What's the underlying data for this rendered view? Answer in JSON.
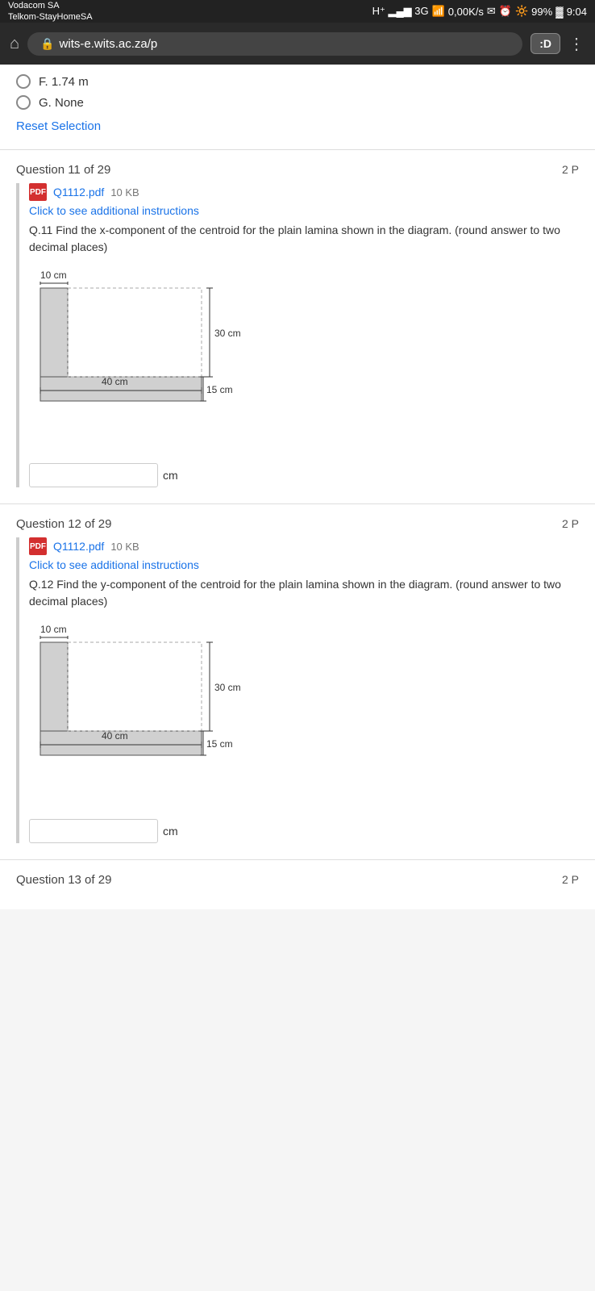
{
  "statusBar": {
    "carrier1": "Vodacom SA",
    "carrier2": "Telkom-StayHomeSA",
    "signal": "H⁺",
    "network": "3G",
    "wifi": "0,00K/s",
    "icons": "M O O",
    "battery": "99%",
    "time": "9:04"
  },
  "browser": {
    "url": "wits-e.wits.ac.za/p",
    "badge": ":D"
  },
  "prevQuestion": {
    "optionF": "F. 1.74 m",
    "optionG": "G. None",
    "resetLabel": "Reset Selection"
  },
  "question11": {
    "number": "Question 11 of 29",
    "points": "2 P",
    "pdfName": "Q1112.pdf",
    "pdfSize": "10 KB",
    "additionalLink": "Click to see additional instructions",
    "text": "Q.11 Find the x-component of the centroid for the plain lamina shown in the diagram. (round answer to two decimal places)",
    "diagramLabel10cm": "10 cm",
    "dim30cm": "30 cm",
    "dim40cm": "40 cm",
    "dim15cm": "15 cm",
    "answerUnit": "cm"
  },
  "question12": {
    "number": "Question 12 of 29",
    "points": "2 P",
    "pdfName": "Q1112.pdf",
    "pdfSize": "10 KB",
    "additionalLink": "Click to see additional instructions",
    "text": "Q.12 Find the y-component of the centroid for the plain lamina shown in the diagram. (round answer to two decimal places)",
    "diagramLabel10cm": "10 cm",
    "dim30cm": "30 cm",
    "dim40cm": "40 cm",
    "dim15cm": "15 cm",
    "answerUnit": "cm"
  },
  "question13": {
    "number": "Question 13 of 29",
    "points": "2 P"
  }
}
